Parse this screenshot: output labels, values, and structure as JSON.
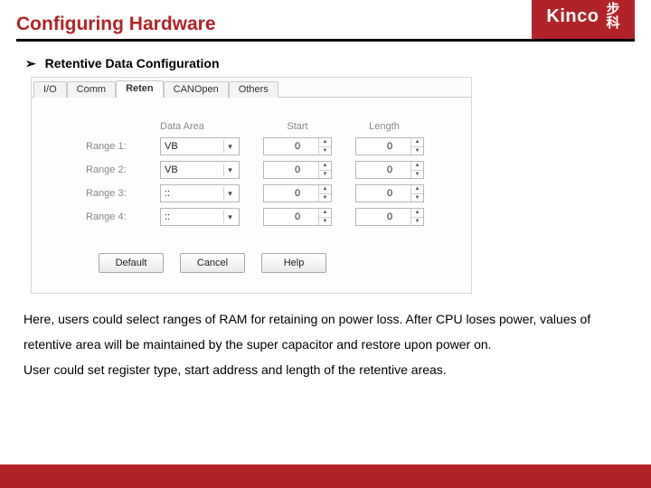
{
  "header": {
    "title": "Configuring Hardware",
    "logo_en": "Kinco",
    "logo_cn1": "步",
    "logo_cn2": "科"
  },
  "bullet": {
    "marker": "➢",
    "text": "Retentive Data Configuration"
  },
  "dialog": {
    "tabs": [
      "I/O",
      "Comm",
      "Reten",
      "CANOpen",
      "Others"
    ],
    "active_tab_index": 2,
    "columns": [
      "Data Area",
      "Start",
      "Length"
    ],
    "rows": [
      {
        "label": "Range 1:",
        "area": "VB",
        "start": "0",
        "length": "0"
      },
      {
        "label": "Range 2:",
        "area": "VB",
        "start": "0",
        "length": "0"
      },
      {
        "label": "Range 3:",
        "area": "::",
        "start": "0",
        "length": "0"
      },
      {
        "label": "Range 4:",
        "area": "::",
        "start": "0",
        "length": "0"
      }
    ],
    "buttons": {
      "default": "Default",
      "cancel": "Cancel",
      "help": "Help"
    }
  },
  "body": {
    "p1": "Here, users could select ranges of RAM for retaining on power loss. After CPU loses power, values of retentive area will be maintained by the super capacitor and restore upon power on.",
    "p2": "User could set register type, start address and length of the retentive areas."
  }
}
